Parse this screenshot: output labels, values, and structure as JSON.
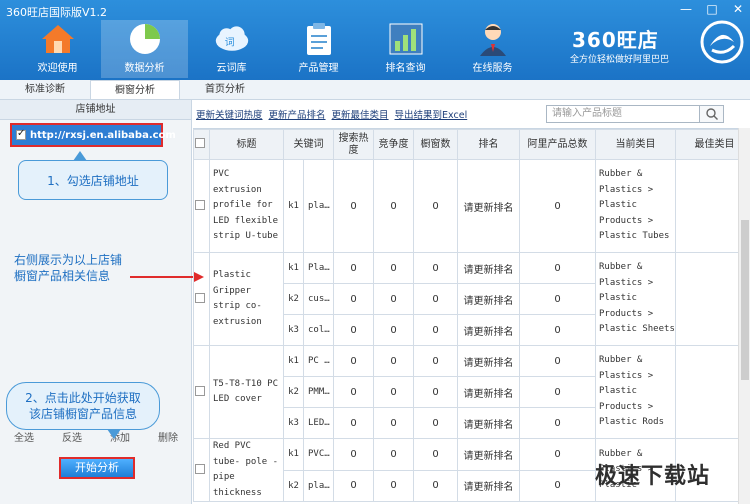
{
  "window": {
    "title": "360旺店国际版V1.2",
    "controls": [
      "—",
      "□",
      "✕"
    ]
  },
  "toolbar": [
    {
      "label": "欢迎使用",
      "icon": "home-icon"
    },
    {
      "label": "数据分析",
      "icon": "pie-chart-icon"
    },
    {
      "label": "云词库",
      "icon": "cloud-icon"
    },
    {
      "label": "产品管理",
      "icon": "clipboard-icon"
    },
    {
      "label": "排名查询",
      "icon": "ranking-icon"
    },
    {
      "label": "在线服务",
      "icon": "agent-icon"
    }
  ],
  "brand": {
    "name": "360旺店",
    "slogan": "全方位轻松做好阿里巴巴"
  },
  "tabs": [
    "标准诊断",
    "橱窗分析",
    "首页分析"
  ],
  "left": {
    "header": "店铺地址",
    "store_url": "http://rxsj.en.alibaba.com",
    "callout1": "1、勾选店铺地址",
    "info_line1": "右侧展示为以上店铺",
    "info_line2": "橱窗产品相关信息",
    "callout2_line1": "2、点击此处开始获取",
    "callout2_line2": "该店铺橱窗产品信息",
    "links": [
      "全选",
      "反选",
      "添加",
      "删除"
    ],
    "start_button": "开始分析"
  },
  "right": {
    "actions": [
      "更新关键词热度",
      "更新产品排名",
      "更新最佳类目",
      "导出结果到Excel"
    ],
    "search_placeholder": "请输入产品标题",
    "columns": [
      "标题",
      "关键词",
      "搜索热度",
      "竞争度",
      "橱窗数",
      "排名",
      "阿里产品总数",
      "当前类目",
      "最佳类目"
    ],
    "rows": [
      {
        "title": "PVC extrusion profile for LED flexible strip U-tube",
        "category": "Rubber & Plastics > Plastic Products > Plastic Tubes",
        "keywords": [
          {
            "k": "k1",
            "kw": "pla…",
            "hot": "0",
            "comp": "0",
            "win": "0",
            "rank": "请更新排名",
            "total": "0"
          }
        ]
      },
      {
        "title": "Plastic Gripper strip co-extrusion",
        "category": "Rubber & Plastics > Plastic Products > Plastic Sheets",
        "keywords": [
          {
            "k": "k1",
            "kw": "Pla…",
            "hot": "0",
            "comp": "0",
            "win": "0",
            "rank": "请更新排名",
            "total": "0"
          },
          {
            "k": "k2",
            "kw": "cus…",
            "hot": "0",
            "comp": "0",
            "win": "0",
            "rank": "请更新排名",
            "total": "0"
          },
          {
            "k": "k3",
            "kw": "col…",
            "hot": "0",
            "comp": "0",
            "win": "0",
            "rank": "请更新排名",
            "total": "0"
          }
        ]
      },
      {
        "title": "T5-T8-T10 PC LED cover",
        "category": "Rubber & Plastics > Plastic Products > Plastic Rods",
        "keywords": [
          {
            "k": "k1",
            "kw": "PC …",
            "hot": "0",
            "comp": "0",
            "win": "0",
            "rank": "请更新排名",
            "total": "0"
          },
          {
            "k": "k2",
            "kw": "PMM…",
            "hot": "0",
            "comp": "0",
            "win": "0",
            "rank": "请更新排名",
            "total": "0"
          },
          {
            "k": "k3",
            "kw": "LED…",
            "hot": "0",
            "comp": "0",
            "win": "0",
            "rank": "请更新排名",
            "total": "0"
          }
        ]
      },
      {
        "title": "Red PVC tube- pole - pipe thickness",
        "category": "Rubber & Plastics > Plastic",
        "keywords": [
          {
            "k": "k1",
            "kw": "PVC…",
            "hot": "0",
            "comp": "0",
            "win": "0",
            "rank": "请更新排名",
            "total": "0"
          },
          {
            "k": "k2",
            "kw": "pla…",
            "hot": "0",
            "comp": "0",
            "win": "0",
            "rank": "请更新排名",
            "total": "0"
          }
        ]
      }
    ]
  },
  "watermark": "极速下载站"
}
